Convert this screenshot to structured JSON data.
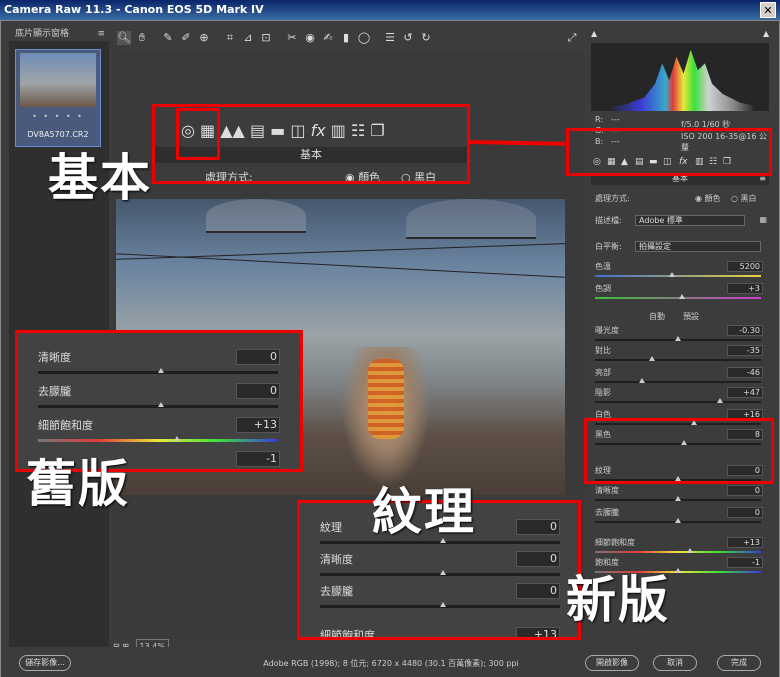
{
  "window": {
    "title": "Camera Raw 11.3  -  Canon EOS 5D Mark IV",
    "close": "✕"
  },
  "filmstrip": {
    "header": "底片顯示窗格",
    "menu_icon": "≡",
    "thumb_stars": "• • • • •",
    "thumb_name": "DV8A5707.CR2"
  },
  "toolbar": {
    "icons": [
      "zoom-icon",
      "hand-icon",
      "white-balance-icon",
      "color-sampler-icon",
      "target-adjust-icon",
      "crop-icon",
      "straighten-icon",
      "transform-icon",
      "spot-removal-icon",
      "red-eye-icon",
      "brush-icon",
      "graduated-filter-icon",
      "radial-filter-icon",
      "preferences-icon",
      "rotate-left-icon",
      "rotate-right-icon"
    ],
    "fullscreen_icon": "⤢"
  },
  "histogram": {
    "info_left": [
      "f/",
      "ISO",
      "—"
    ],
    "info_right": [
      "f/5.0   1/60 秒",
      "ISO 200   16-35@16 公釐"
    ],
    "rgb_labels": [
      "R:",
      "G:",
      "B:"
    ],
    "rgb_values": [
      "---",
      "---",
      "---"
    ]
  },
  "panel": {
    "title": "基本",
    "menu_icon": "≡",
    "treatment_label": "處理方式:",
    "color_label": "顏色",
    "bw_label": "黑白",
    "profile_label": "描述檔:",
    "profile_value": "Adobe 標準",
    "wb_label": "白平衡:",
    "wb_value": "拍攝設定",
    "temp_label": "色溫",
    "temp_value": "5200",
    "tint_label": "色調",
    "tint_value": "+3",
    "auto_label": "自動",
    "default_label": "預設",
    "exposure_label": "曝光度",
    "exposure_value": "-0.30",
    "contrast_label": "對比",
    "contrast_value": "-35",
    "highlights_label": "亮部",
    "highlights_value": "-46",
    "shadows_label": "陰影",
    "shadows_value": "+47",
    "whites_label": "白色",
    "whites_value": "+16",
    "blacks_label": "黑色",
    "blacks_value": "8",
    "texture_label": "紋理",
    "texture_value": "0",
    "clarity_label": "清晰度",
    "clarity_value": "0",
    "dehaze_label": "去朦朧",
    "dehaze_value": "0",
    "vibrance_label": "細節飽和度",
    "vibrance_value": "+13",
    "saturation_label": "飽和度",
    "saturation_value": "-1"
  },
  "zoom": {
    "minus": "⊟",
    "plus": "⊞",
    "value": "13.4%"
  },
  "bottom": {
    "save_label": "儲存影像...",
    "workflow": "Adobe RGB (1998); 8 位元; 6720 x 4480 (30.1 百萬像素); 300 ppi",
    "open_label": "開啟影像",
    "cancel_label": "取消",
    "done_label": "完成"
  },
  "annotations": {
    "basic_zoom_title": "基本",
    "basic_zoom_treatment": "處理方式:",
    "basic_zoom_color": "顏色",
    "basic_zoom_bw": "黑白",
    "label_basic": "基本",
    "label_old": "舊版",
    "label_texture": "紋理",
    "label_new": "新版",
    "old_rows": [
      {
        "label": "清晰度",
        "value": "0"
      },
      {
        "label": "去朦朧",
        "value": "0"
      },
      {
        "label": "細節飽和度",
        "value": "+13"
      },
      {
        "label": "",
        "value": "-1"
      }
    ],
    "new_rows": [
      {
        "label": "紋理",
        "value": "0"
      },
      {
        "label": "清晰度",
        "value": "0"
      },
      {
        "label": "去朦朧",
        "value": "0"
      },
      {
        "label": "細節飽和度",
        "value": "+13"
      }
    ]
  }
}
